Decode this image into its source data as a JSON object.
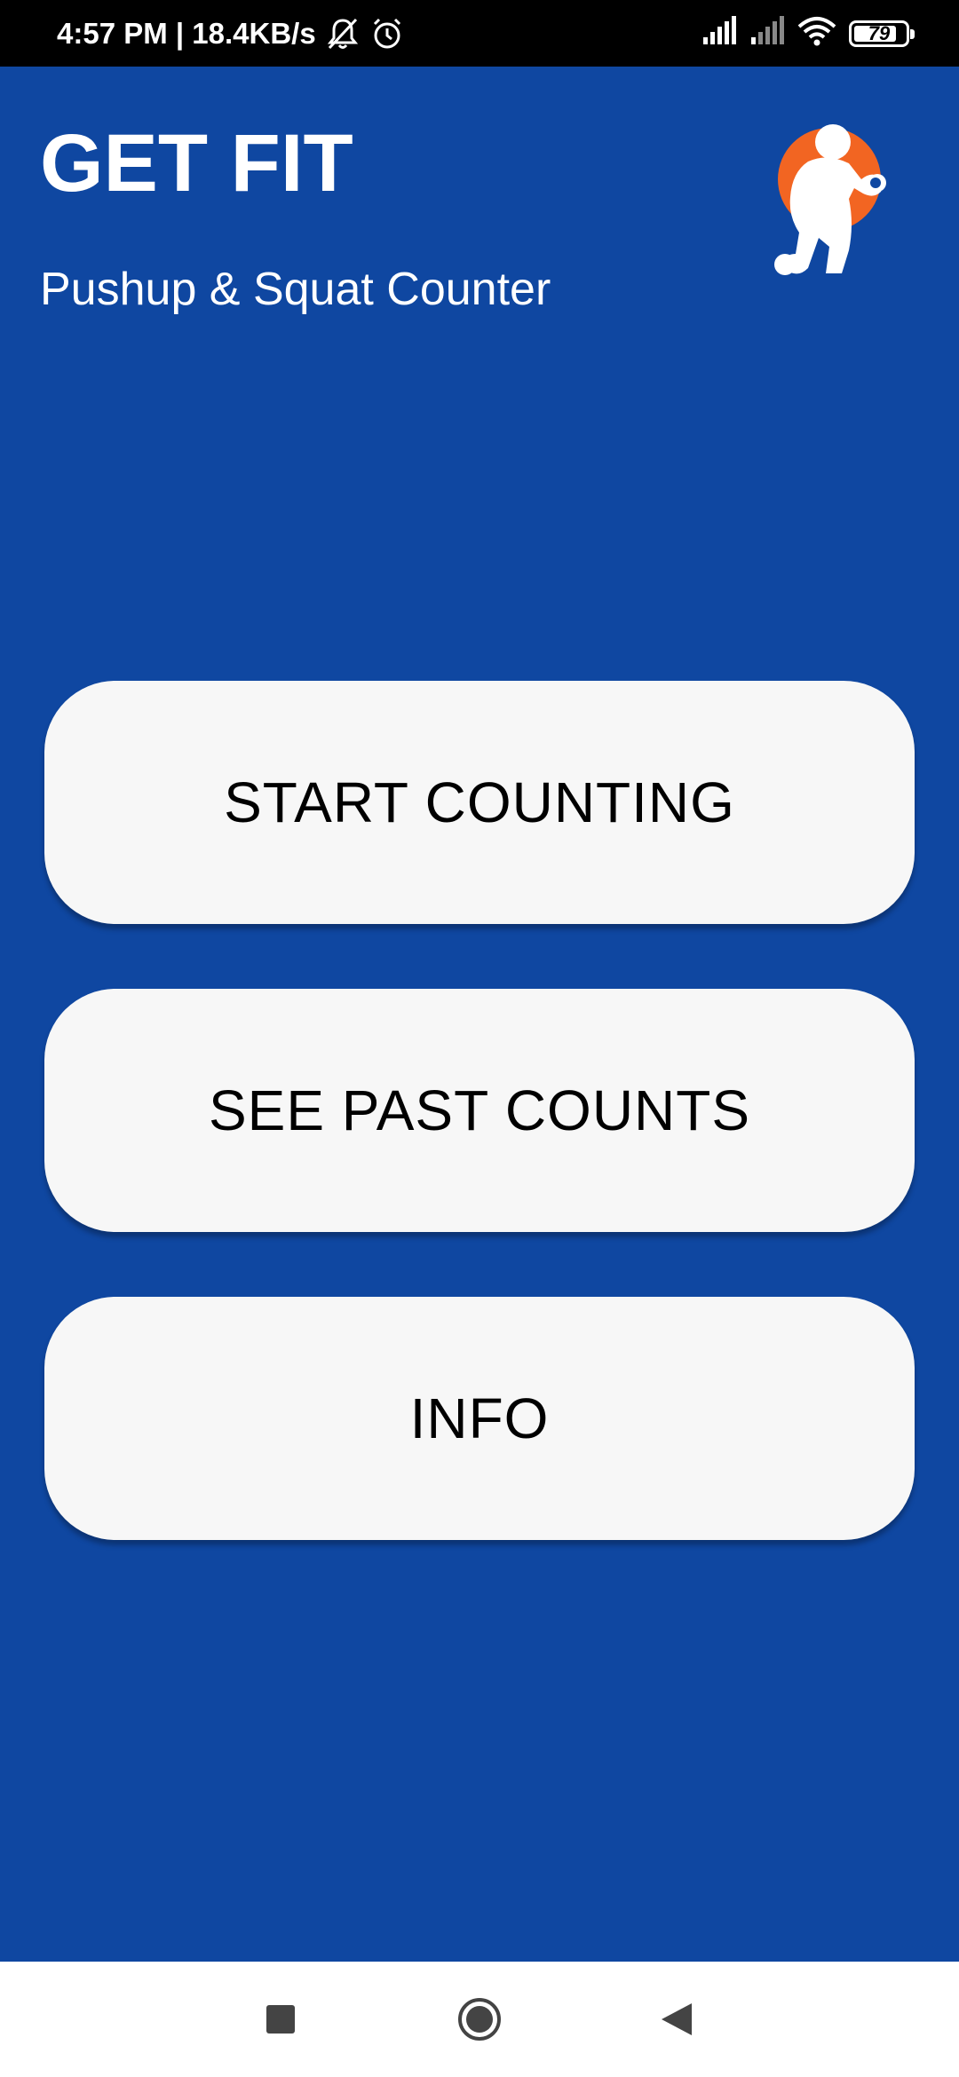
{
  "status_bar": {
    "time_and_speed": "4:57 PM | 18.4KB/s",
    "battery_level": "79",
    "icons": [
      "notifications-off-icon",
      "alarm-icon",
      "signal-icon",
      "signal-weak-icon",
      "wifi-icon",
      "battery-icon"
    ]
  },
  "header": {
    "title": "GET FIT",
    "subtitle": "Pushup & Squat Counter",
    "logo_icon": "fitness-logo-icon"
  },
  "buttons": {
    "start": "START COUNTING",
    "past": "SEE PAST COUNTS",
    "info": "INFO"
  },
  "nav_bar": {
    "icons": [
      "recents-icon",
      "home-icon",
      "back-icon"
    ]
  },
  "colors": {
    "background": "#0f47a1",
    "button": "#f7f7f7",
    "logo_accent": "#f26522",
    "status_bar": "#000000",
    "nav_bar": "#ffffff"
  }
}
